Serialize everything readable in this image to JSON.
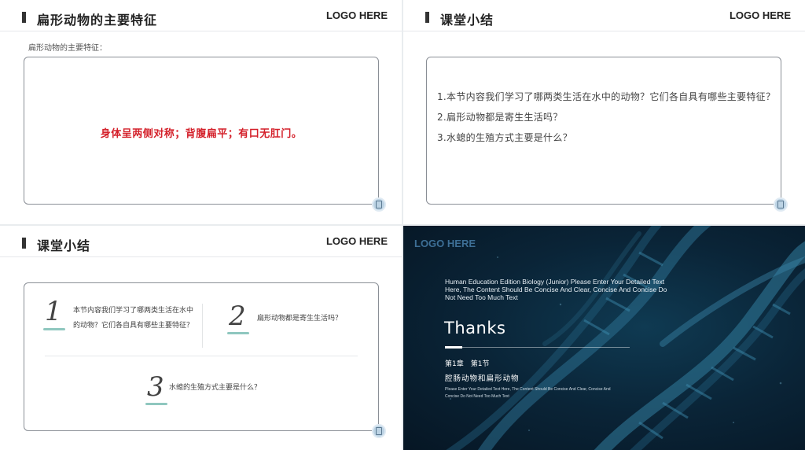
{
  "slides": {
    "s1": {
      "title": "扁形动物的主要特征",
      "logo": "LOGO HERE",
      "subtitle": "扁形动物的主要特征：",
      "highlight": "身体呈两侧对称；背腹扁平；有口无肛门。"
    },
    "s2": {
      "title": "课堂小结",
      "logo": "LOGO HERE",
      "questions": [
        "1.本节内容我们学习了哪两类生活在水中的动物？它们各自具有哪些主要特征？",
        "2.扁形动物都是寄生生活吗？",
        "3.水螅的生殖方式主要是什么？"
      ]
    },
    "s3": {
      "title": "课堂小结",
      "logo": "LOGO HERE",
      "items": [
        {
          "num": "1",
          "text_line1": "本节内容我们学习了哪两类生活在水中",
          "text_line2": "的动物？它们各自具有哪些主要特征？"
        },
        {
          "num": "2",
          "text_line1": "扁形动物都是寄生生活吗？",
          "text_line2": ""
        },
        {
          "num": "3",
          "text_line1": "水螅的生殖方式主要是什么？",
          "text_line2": ""
        }
      ],
      "accent_color": "#8fc7bf"
    },
    "s4": {
      "logo": "LOGO HERE",
      "description": "Human Education Edition Biology (Junior) Please Enter Your Detailed Text Here, The Content Should Be Concise And Clear, Concise And Concise Do Not Need Too Much Text",
      "thanks": "Thanks",
      "chapter": "第1章　第1节",
      "subtitle": "腔肠动物和扁形动物",
      "small_text": "Please Enter Your Detailed Text Here, The Content Should Be Concise And Clear, Concise And Concise Do Not Need Too Much Text",
      "background_color": "#0a2437"
    }
  }
}
